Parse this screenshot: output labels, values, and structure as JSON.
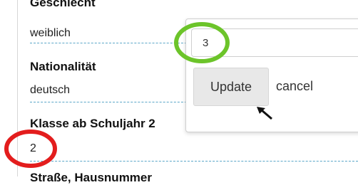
{
  "fields": [
    {
      "label": "Geschlecht",
      "value": "weiblich"
    },
    {
      "label": "Nationalität",
      "value": "deutsch"
    },
    {
      "label": "Klasse ab Schuljahr 2",
      "value": "2"
    },
    {
      "label": "Straße, Hausnummer"
    }
  ],
  "editor": {
    "input_value": "3",
    "update_label": "Update",
    "cancel_label": "cancel"
  },
  "annotations": {
    "green_circle_color": "#6cc42a",
    "red_circle_color": "#e31d1d",
    "arrow_color": "#111111"
  }
}
